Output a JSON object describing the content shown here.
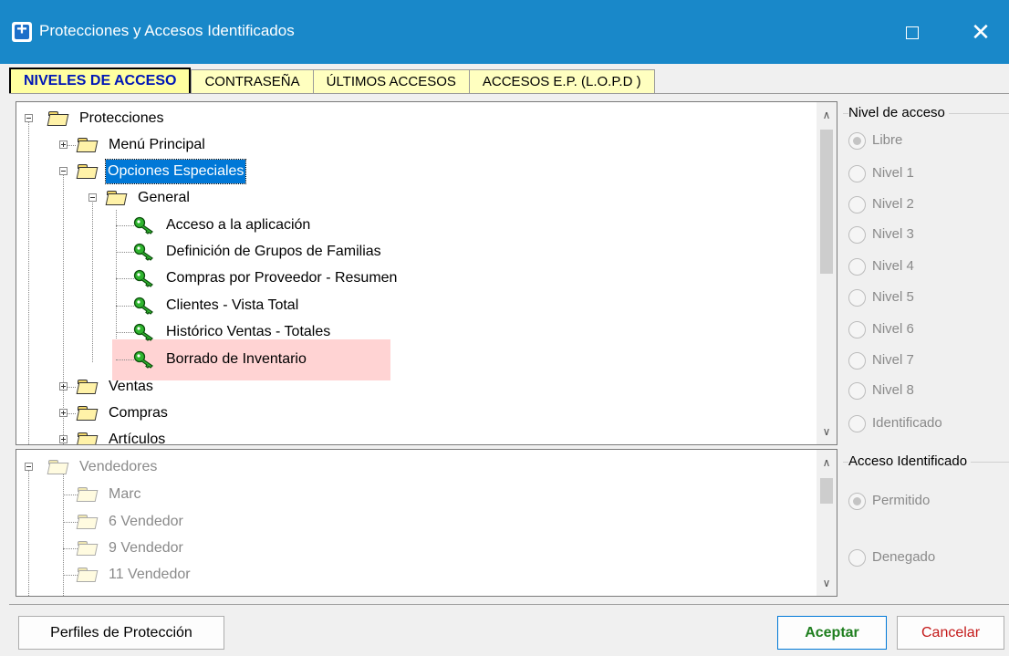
{
  "window": {
    "title": "Protecciones y Accesos Identificados",
    "maximize_label": "",
    "close_label": "✕"
  },
  "tabs": [
    {
      "label": "NIVELES DE ACCESO",
      "active": true
    },
    {
      "label": "CONTRASEÑA",
      "active": false
    },
    {
      "label": "ÚLTIMOS ACCESOS",
      "active": false
    },
    {
      "label": "ACCESOS E.P. (L.O.P.D )",
      "active": false
    }
  ],
  "tree_protecciones": {
    "nodes": [
      {
        "label": "Protecciones",
        "icon": "folder-open-icon",
        "expanded": true
      },
      {
        "label": "Menú Principal",
        "icon": "folder-open-icon",
        "expanded": false
      },
      {
        "label": "Opciones Especiales",
        "icon": "folder-open-icon",
        "expanded": true,
        "selected": true
      },
      {
        "label": "General",
        "icon": "folder-open-icon",
        "expanded": true
      },
      {
        "label": "Acceso a la aplicación",
        "icon": "key-icon"
      },
      {
        "label": "Definición de Grupos de Familias",
        "icon": "key-icon"
      },
      {
        "label": "Compras por Proveedor - Resumen",
        "icon": "key-icon"
      },
      {
        "label": "Clientes - Vista Total",
        "icon": "key-icon"
      },
      {
        "label": "Histórico Ventas - Totales",
        "icon": "key-icon"
      },
      {
        "label": "Borrado de Inventario",
        "icon": "key-icon",
        "highlighted": true
      },
      {
        "label": "Ventas",
        "icon": "folder-open-icon",
        "expanded": false
      },
      {
        "label": "Compras",
        "icon": "folder-open-icon",
        "expanded": false
      },
      {
        "label": "Artículos",
        "icon": "folder-open-icon",
        "expanded": false
      }
    ]
  },
  "tree_vendedores": {
    "nodes": [
      {
        "label": "Vendedores",
        "icon": "folder-open-icon"
      },
      {
        "label": "Marc",
        "icon": "folder-open-icon"
      },
      {
        "label": "6 Vendedor",
        "icon": "folder-open-icon"
      },
      {
        "label": "9 Vendedor",
        "icon": "folder-open-icon"
      },
      {
        "label": "11 Vendedor",
        "icon": "folder-open-icon"
      }
    ]
  },
  "nivel_acceso": {
    "title": "Nivel de acceso",
    "options": [
      {
        "label": "Libre",
        "checked": true
      },
      {
        "label": "Nivel 1",
        "checked": false
      },
      {
        "label": "Nivel 2",
        "checked": false
      },
      {
        "label": "Nivel 3",
        "checked": false
      },
      {
        "label": "Nivel 4",
        "checked": false
      },
      {
        "label": "Nivel 5",
        "checked": false
      },
      {
        "label": "Nivel 6",
        "checked": false
      },
      {
        "label": "Nivel 7",
        "checked": false
      },
      {
        "label": "Nivel 8",
        "checked": false
      },
      {
        "label": "Identificado",
        "checked": false
      }
    ]
  },
  "acceso_identificado": {
    "title": "Acceso Identificado",
    "options": [
      {
        "label": "Permitido",
        "checked": true
      },
      {
        "label": "Denegado",
        "checked": false
      }
    ]
  },
  "buttons": {
    "profiles": "Perfiles de Protección",
    "accept": "Aceptar",
    "cancel": "Cancelar"
  },
  "colors": {
    "titlebar": "#1988c9",
    "tab_background": "#ffffc0",
    "active_tab_text": "#0016b6",
    "selection": "#0078d7",
    "highlight": "#ffd3d3",
    "accept_text": "#1e7e1e",
    "cancel_text": "#c41a1a"
  }
}
